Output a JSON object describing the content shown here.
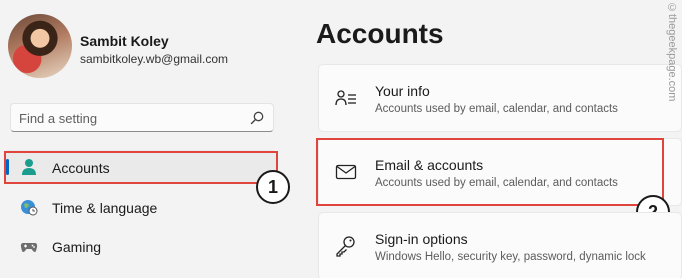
{
  "profile": {
    "name": "Sambit Koley",
    "email": "sambitkoley.wb@gmail.com"
  },
  "search": {
    "placeholder": "Find a setting",
    "icon": "search-icon"
  },
  "nav": {
    "items": [
      {
        "label": "Accounts",
        "icon": "person-icon",
        "selected": true
      },
      {
        "label": "Time & language",
        "icon": "globe-clock-icon"
      },
      {
        "label": "Gaming",
        "icon": "gamepad-icon"
      }
    ]
  },
  "main": {
    "title": "Accounts",
    "cards": [
      {
        "title": "Your info",
        "desc": "Accounts used by email, calendar, and contacts",
        "icon": "person-lines-icon"
      },
      {
        "title": "Email & accounts",
        "desc": "Accounts used by email, calendar, and contacts",
        "icon": "envelope-icon"
      },
      {
        "title": "Sign-in options",
        "desc": "Windows Hello, security key, password, dynamic lock",
        "icon": "key-icon"
      }
    ]
  },
  "annotations": {
    "badge1": "1",
    "badge2": "2"
  },
  "watermark": "©thegeekpage.com",
  "colors": {
    "accent": "#0067c0",
    "highlight_box": "#e0453d",
    "background": "#f3f3f3"
  }
}
